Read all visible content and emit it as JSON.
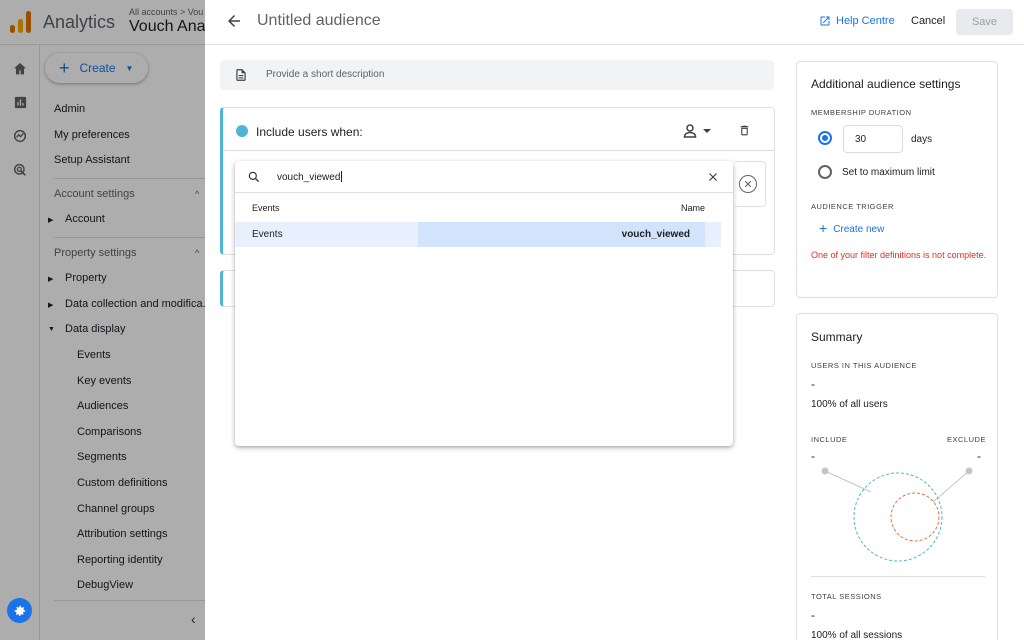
{
  "topbar": {
    "app_name": "Analytics",
    "breadcrumb": "All accounts > Vou",
    "property_name": "Vouch Ana"
  },
  "nav": {
    "create_label": "Create",
    "admin": "Admin",
    "my_preferences": "My preferences",
    "setup_assistant": "Setup Assistant",
    "account_settings": "Account settings",
    "account": "Account",
    "property_settings": "Property settings",
    "property": "Property",
    "data_collection": "Data collection and modifica...",
    "data_display": "Data display",
    "sub_items": [
      "Events",
      "Key events",
      "Audiences",
      "Comparisons",
      "Segments",
      "Custom definitions",
      "Channel groups",
      "Attribution settings",
      "Reporting identity",
      "DebugView"
    ]
  },
  "panel": {
    "title": "Untitled audience",
    "help_label": "Help Centre",
    "cancel_label": "Cancel",
    "save_label": "Save",
    "description_placeholder": "Provide a short description"
  },
  "condition": {
    "title": "Include users when:"
  },
  "dropdown": {
    "search_value": "vouch_viewed",
    "header_left": "Events",
    "header_right": "Name",
    "rows": [
      {
        "category": "Events",
        "name": "vouch_viewed"
      }
    ]
  },
  "settings": {
    "title": "Additional audience settings",
    "membership_caption": "MEMBERSHIP DURATION",
    "days_value": "30",
    "days_label": "days",
    "max_limit_label": "Set to maximum limit",
    "trigger_caption": "AUDIENCE TRIGGER",
    "create_new_label": "Create new",
    "error_text": "One of your filter definitions is not complete."
  },
  "summary": {
    "title": "Summary",
    "users_caption": "USERS IN THIS AUDIENCE",
    "users_value": "-",
    "users_pct": "100% of all users",
    "include_label": "INCLUDE",
    "exclude_label": "EXCLUDE",
    "include_value": "-",
    "exclude_value": "-",
    "sessions_caption": "TOTAL SESSIONS",
    "sessions_value": "-",
    "sessions_pct": "100% of all sessions"
  },
  "colors": {
    "accent": "#1a73e8",
    "condition_bar": "#4fb4d8",
    "error": "#d93025",
    "venn_include": "#4fb4d8",
    "venn_exclude": "#f06a3a"
  }
}
